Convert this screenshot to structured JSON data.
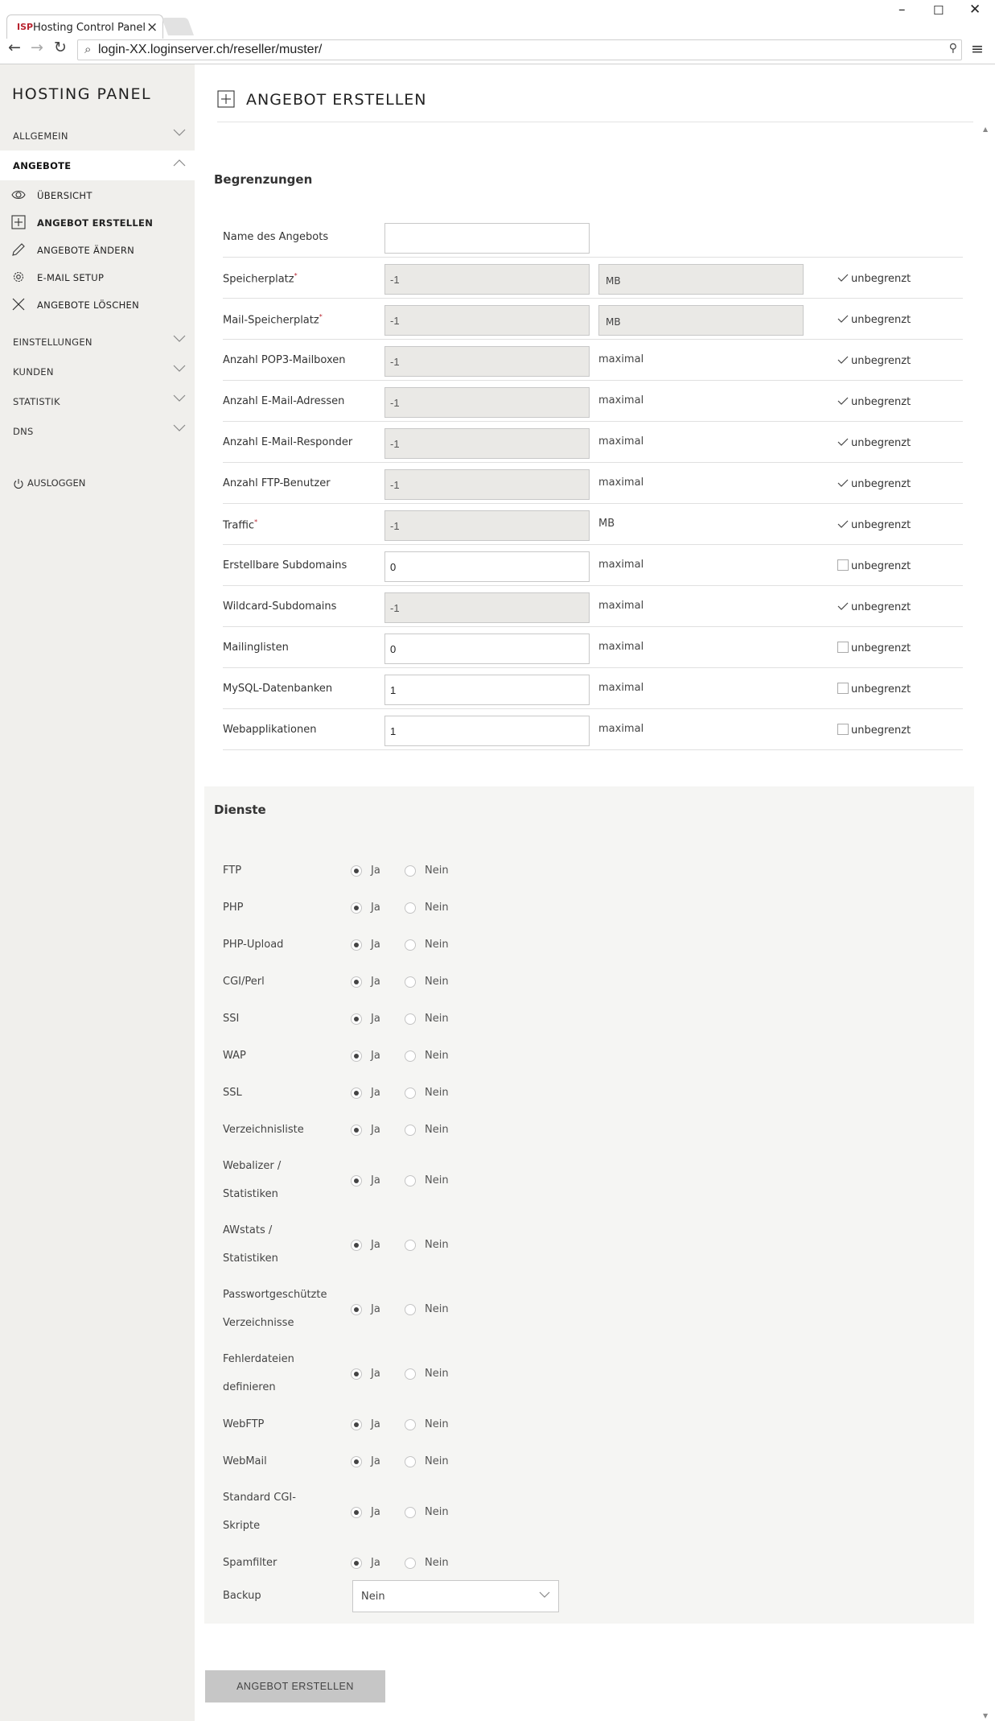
{
  "browser": {
    "tab_title": "Hosting Control Panel",
    "favicon": "ISP",
    "url": "login-XX.loginserver.ch/reseller/muster/"
  },
  "sidebar": {
    "brand": "HOSTING PANEL",
    "menu": [
      {
        "label": "ALLGEMEIN",
        "expanded": false
      },
      {
        "label": "ANGEBOTE",
        "expanded": true,
        "items": [
          {
            "label": "ÜBERSICHT",
            "icon": "eye-icon"
          },
          {
            "label": "ANGEBOT ERSTELLEN",
            "icon": "plus-box-icon",
            "current": true
          },
          {
            "label": "ANGEBOTE ÄNDERN",
            "icon": "pencil-icon"
          },
          {
            "label": "E-MAIL SETUP",
            "icon": "gear-icon"
          },
          {
            "label": "ANGEBOTE LÖSCHEN",
            "icon": "x-icon"
          }
        ]
      },
      {
        "label": "EINSTELLUNGEN",
        "expanded": false
      },
      {
        "label": "KUNDEN",
        "expanded": false
      },
      {
        "label": "STATISTIK",
        "expanded": false
      },
      {
        "label": "DNS",
        "expanded": false
      }
    ],
    "logout": "AUSLOGGEN"
  },
  "page": {
    "title": "ANGEBOT ERSTELLEN"
  },
  "limits": {
    "title": "Begrenzungen",
    "name_label": "Name des Angebots",
    "name_value": "",
    "rows": [
      {
        "label": "Speicherplatz",
        "required": true,
        "value": "-1",
        "disabled": true,
        "unit": "MB",
        "unit_field": true,
        "unlimited": true
      },
      {
        "label": "Mail-Speicherplatz",
        "required": true,
        "value": "-1",
        "disabled": true,
        "unit": "MB",
        "unit_field": true,
        "unlimited": true
      },
      {
        "label": "Anzahl POP3-Mailboxen",
        "value": "-1",
        "disabled": true,
        "unit": "maximal",
        "unlimited": true
      },
      {
        "label": "Anzahl E-Mail-Adressen",
        "value": "-1",
        "disabled": true,
        "unit": "maximal",
        "unlimited": true
      },
      {
        "label": "Anzahl E-Mail-Responder",
        "value": "-1",
        "disabled": true,
        "unit": "maximal",
        "unlimited": true
      },
      {
        "label": "Anzahl FTP-Benutzer",
        "value": "-1",
        "disabled": true,
        "unit": "maximal",
        "unlimited": true
      },
      {
        "label": "Traffic",
        "required": true,
        "value": "-1",
        "disabled": true,
        "unit": "MB",
        "unlimited": true
      },
      {
        "label": "Erstellbare Subdomains",
        "value": "0",
        "disabled": false,
        "unit": "maximal",
        "unlimited": false
      },
      {
        "label": "Wildcard-Subdomains",
        "value": "-1",
        "disabled": true,
        "unit": "maximal",
        "unlimited": true
      },
      {
        "label": "Mailinglisten",
        "value": "0",
        "disabled": false,
        "unit": "maximal",
        "unlimited": false
      },
      {
        "label": "MySQL-Datenbanken",
        "value": "1",
        "disabled": false,
        "unit": "maximal",
        "unlimited": false
      },
      {
        "label": "Webapplikationen",
        "value": "1",
        "disabled": false,
        "unit": "maximal",
        "unlimited": false
      }
    ],
    "unlimited_label": "unbegrenzt"
  },
  "services": {
    "title": "Dienste",
    "yes_label": "Ja",
    "no_label": "Nein",
    "rows": [
      {
        "label": [
          "FTP"
        ],
        "value": "ja"
      },
      {
        "label": [
          "PHP"
        ],
        "value": "ja"
      },
      {
        "label": [
          "PHP-Upload"
        ],
        "value": "ja"
      },
      {
        "label": [
          "CGI/Perl"
        ],
        "value": "ja"
      },
      {
        "label": [
          "SSI"
        ],
        "value": "ja"
      },
      {
        "label": [
          "WAP"
        ],
        "value": "ja"
      },
      {
        "label": [
          "SSL"
        ],
        "value": "ja"
      },
      {
        "label": [
          "Verzeichnisliste"
        ],
        "value": "ja"
      },
      {
        "label": [
          "Webalizer /",
          "Statistiken"
        ],
        "value": "ja"
      },
      {
        "label": [
          "AWstats /",
          "Statistiken"
        ],
        "value": "ja"
      },
      {
        "label": [
          "Passwortgeschützte",
          "Verzeichnisse"
        ],
        "value": "ja"
      },
      {
        "label": [
          "Fehlerdateien",
          "definieren"
        ],
        "value": "ja"
      },
      {
        "label": [
          "WebFTP"
        ],
        "value": "ja"
      },
      {
        "label": [
          "WebMail"
        ],
        "value": "ja"
      },
      {
        "label": [
          "Standard CGI-",
          "Skripte"
        ],
        "value": "ja"
      },
      {
        "label": [
          "Spamfilter"
        ],
        "value": "ja"
      }
    ],
    "backup_label": "Backup",
    "backup_value": "Nein"
  },
  "submit_label": "ANGEBOT ERSTELLEN"
}
